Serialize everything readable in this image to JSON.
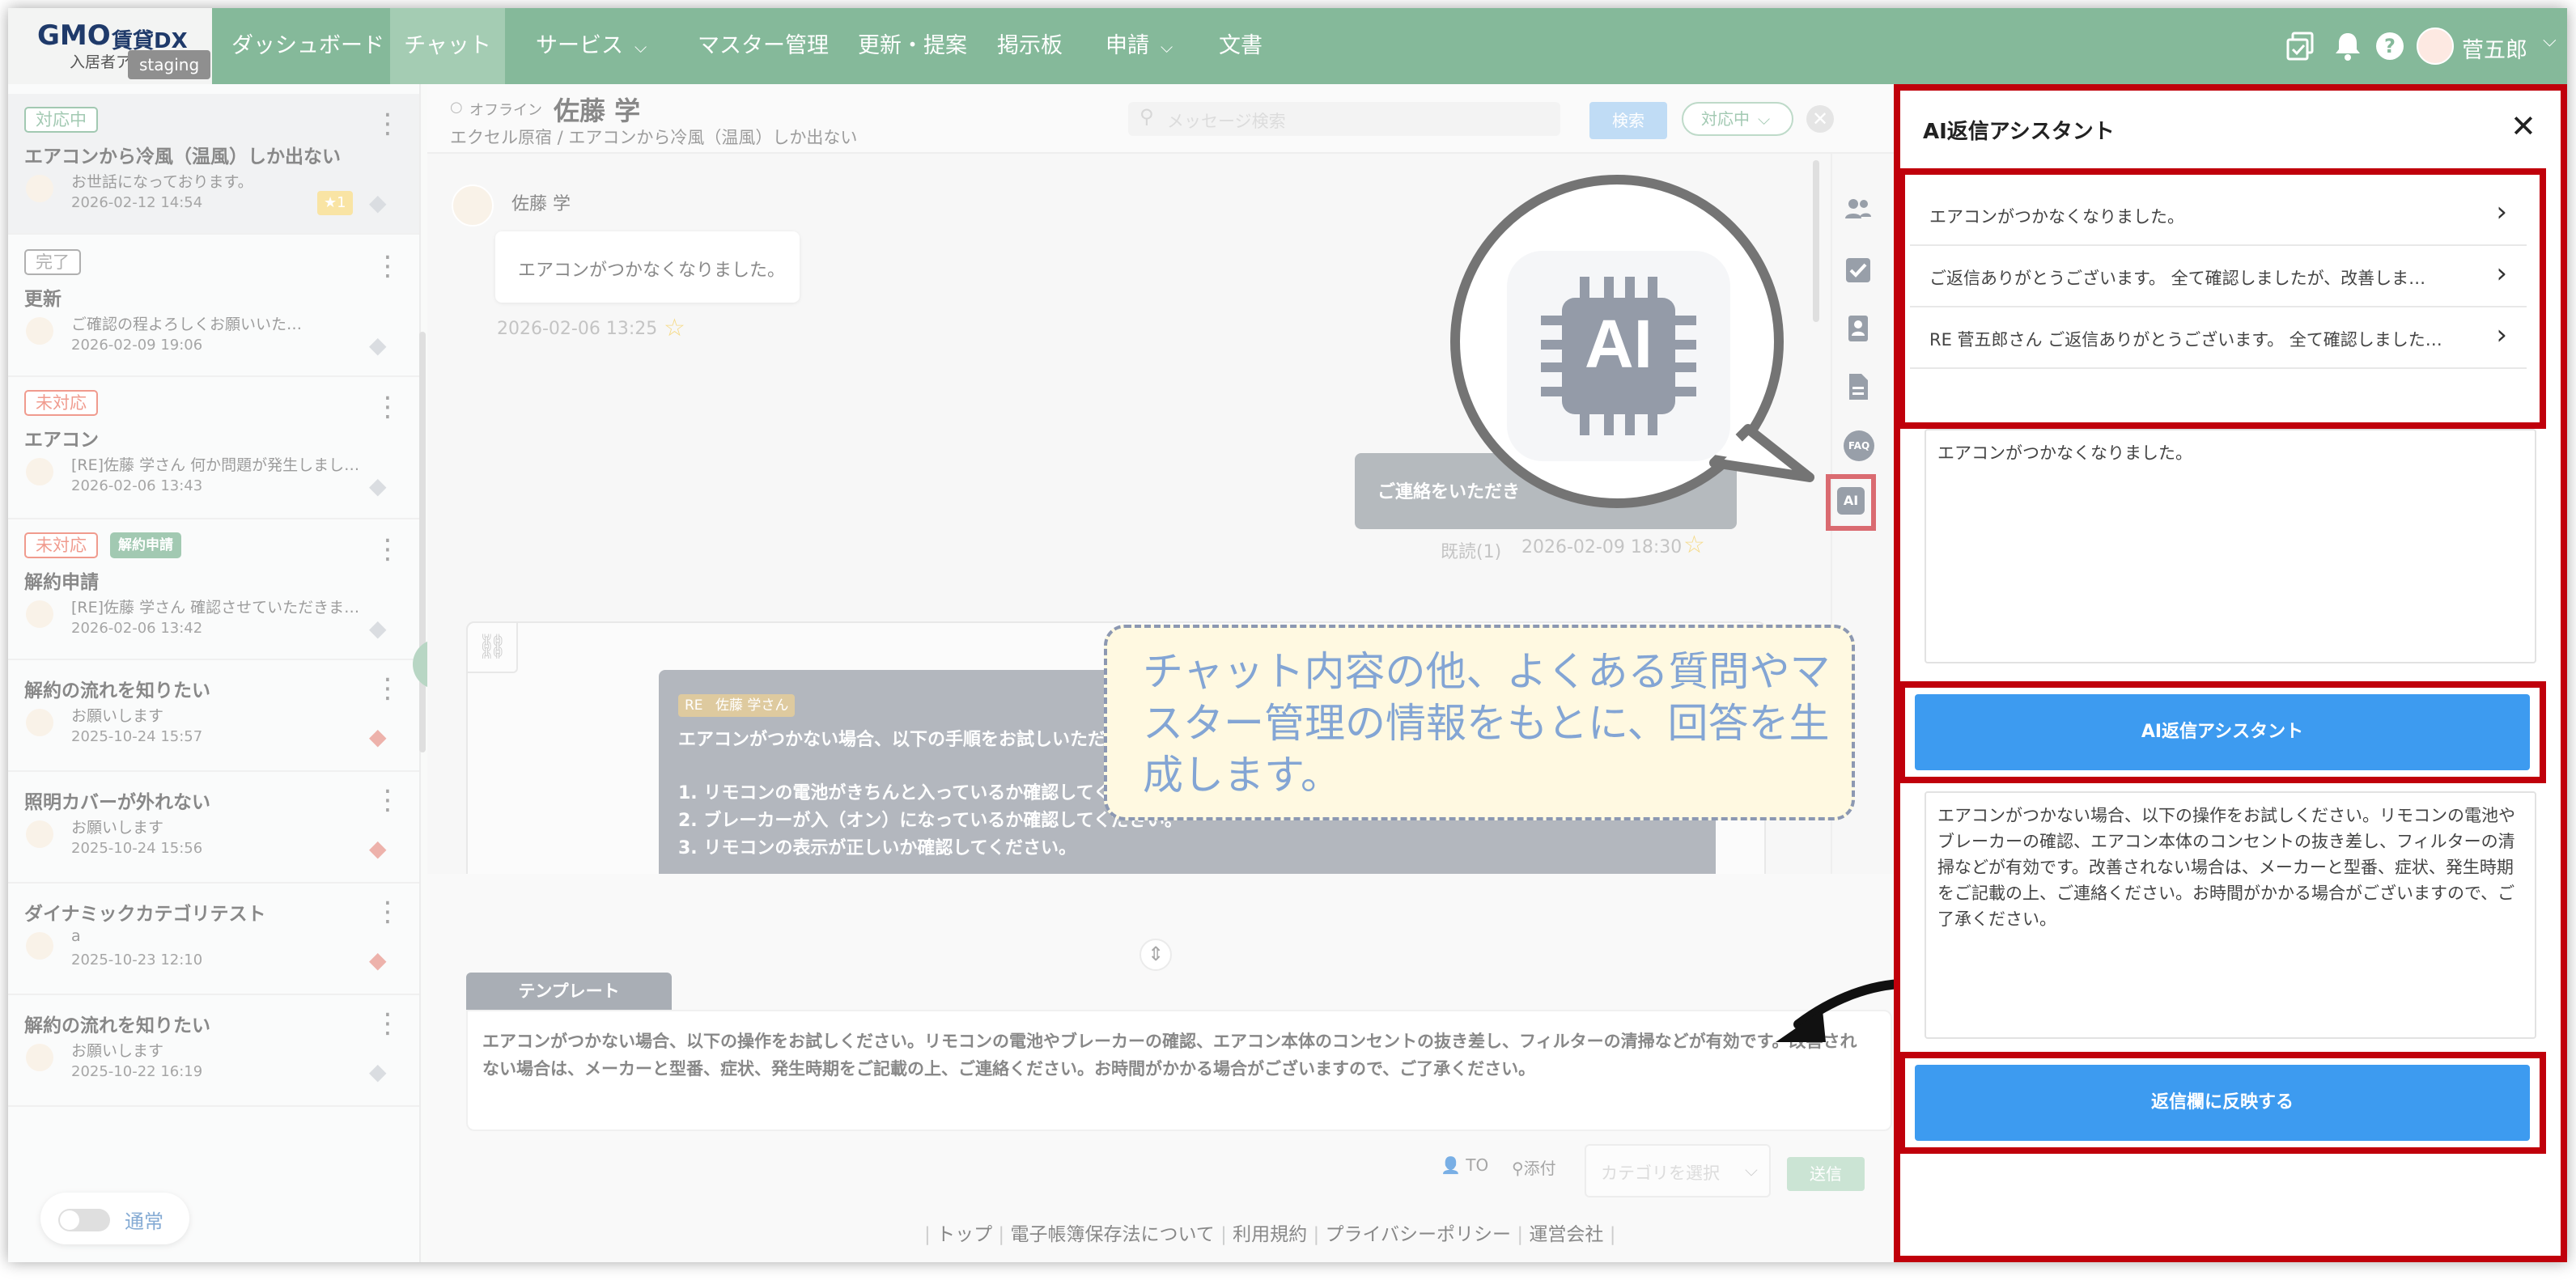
{
  "header": {
    "logo_brand": "GMO",
    "logo_product": "賃貸DX",
    "logo_sub": "入居者アプ",
    "env_badge": "staging",
    "nav": [
      {
        "label": "ダッシュボード"
      },
      {
        "label": "チャット"
      },
      {
        "label": "サービス"
      },
      {
        "label": "マスター管理"
      },
      {
        "label": "更新・提案"
      },
      {
        "label": "掲示板"
      },
      {
        "label": "申請"
      },
      {
        "label": "文書"
      }
    ],
    "user_name": "菅五郎"
  },
  "chat_header": {
    "status": "オフライン",
    "name": "佐藤 学",
    "subtitle": "エクセル原宿 / エアコンから冷風（温風）しか出ない",
    "search_placeholder": "メッセージ検索",
    "search_button": "検索",
    "status_select": "対応中"
  },
  "conversations": [
    {
      "badge": "対応中",
      "extra_badge": "",
      "title": "エアコンから冷風（温風）しか出ない",
      "preview": "お世話になっております。",
      "date": "2026-02-12 14:54",
      "star_count": "★1"
    },
    {
      "badge": "完了",
      "extra_badge": "",
      "title": "更新",
      "preview": "ご確認の程よろしくお願いいた…",
      "date": "2026-02-09 19:06",
      "star_count": ""
    },
    {
      "badge": "未対応",
      "extra_badge": "",
      "title": "エアコン",
      "preview": "[RE]佐藤 学さん 何か問題が発生しまし…",
      "date": "2026-02-06 13:43",
      "star_count": ""
    },
    {
      "badge": "未対応",
      "extra_badge": "解約申請",
      "title": "解約申請",
      "preview": "[RE]佐藤 学さん 確認させていただきま…",
      "date": "2026-02-06 13:42",
      "star_count": ""
    },
    {
      "badge": "",
      "extra_badge": "",
      "title": "解約の流れを知りたい",
      "preview": "お願いします",
      "date": "2025-10-24 15:57",
      "star_count": ""
    },
    {
      "badge": "",
      "extra_badge": "",
      "title": "照明カバーが外れない",
      "preview": "お願いします",
      "date": "2025-10-24 15:56",
      "star_count": ""
    },
    {
      "badge": "",
      "extra_badge": "",
      "title": "ダイナミックカテゴリテスト",
      "preview": "a",
      "date": "2025-10-23 12:10",
      "star_count": ""
    },
    {
      "badge": "",
      "extra_badge": "",
      "title": "解約の流れを知りたい",
      "preview": "お願いします",
      "date": "2025-10-22 16:19",
      "star_count": ""
    }
  ],
  "toggle_label": "通常",
  "messages": {
    "incoming_sender": "佐藤 学",
    "incoming_text": "エアコンがつかなくなりました。",
    "incoming_time": "2026-02-06 13:25",
    "outgoing_text": "ご連絡をいただき",
    "outgoing_read": "既読(1)",
    "outgoing_time": "2026-02-09 18:30",
    "draft_re_label": "RE",
    "draft_re_name": "佐藤 学さん",
    "draft_line1": "エアコンがつかない場合、以下の手順をお試しいただ",
    "draft_item1": "1. リモコンの電池がきちんと入っているか確認してく",
    "draft_item2": "2. ブレーカーが入（オン）になっているか確認してください。",
    "draft_item3": "3. リモコンの表示が正しいか確認してください。"
  },
  "side_icons": {
    "faq_label": "FAQ",
    "ai_label": "AI"
  },
  "callout": {
    "ai_badge": "AI",
    "note": "チャット内容の他、よくある質問やマスター管理の情報をもとに、回答を生成します。"
  },
  "composer": {
    "template_tab": "テンプレート",
    "text": "エアコンがつかない場合、以下の操作をお試しください。リモコンの電池やブレーカーの確認、エアコン本体のコンセントの抜き差し、フィルターの清掃などが有効です。改善されない場合は、メーカーと型番、症状、発生時期をご記載の上、ご連絡ください。お時間がかかる場合がございますので、ご了承ください。",
    "to_label": "TO",
    "attach_label": "添付",
    "category_placeholder": "カテゴリを選択",
    "send_button": "送信"
  },
  "footer": {
    "links": [
      "トップ",
      "電子帳簿保存法について",
      "利用規約",
      "プライバシーポリシー",
      "運営会社"
    ]
  },
  "ai_panel": {
    "title": "AI返信アシスタント",
    "suggestions": [
      "エアコンがつかなくなりました。",
      "ご返信ありがとうございます。 全て確認しましたが、改善しま…",
      "RE 菅五郎さん ご返信ありがとうございます。 全て確認しました…"
    ],
    "input_text": "エアコンがつかなくなりました。",
    "generate_button": "AI返信アシスタント",
    "output_text": "エアコンがつかない場合、以下の操作をお試しください。リモコンの電池やブレーカーの確認、エアコン本体のコンセントの抜き差し、フィルターの清掃などが有効です。改善されない場合は、メーカーと型番、症状、発生時期をご記載の上、ご連絡ください。お時間がかかる場合がございますので、ご了承ください。",
    "apply_button": "返信欄に反映する"
  },
  "colors": {
    "header_green": "#85b99a",
    "highlight_red": "#c0000b",
    "button_blue": "#3d9bf0",
    "callout_bg": "#fff5cc",
    "callout_border": "#3a4f7a"
  }
}
